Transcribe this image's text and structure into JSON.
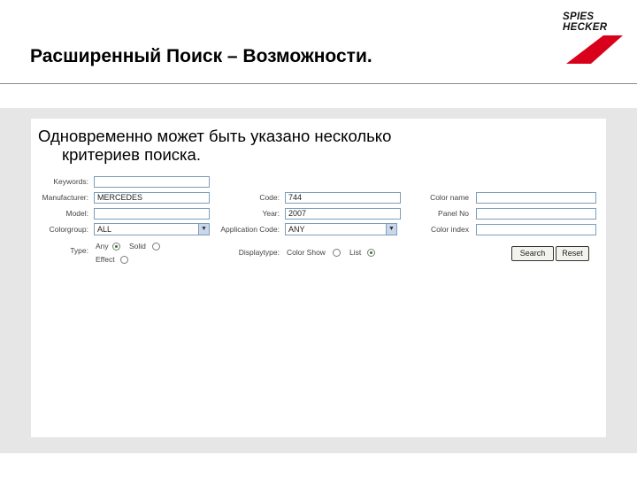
{
  "slide": {
    "title": "Расширенный Поиск – Возможности.",
    "logo_line1": "SPIES",
    "logo_line2": "HECKER",
    "brand_color": "#d9001b",
    "intro_line1": "Одновременно может быть указано несколько",
    "intro_line2": "критериев поиска."
  },
  "form": {
    "keywords_label": "Keywords:",
    "keywords_value": "",
    "manufacturer_label": "Manufacturer:",
    "manufacturer_value": "MERCEDES",
    "model_label": "Model:",
    "model_value": "",
    "colorgroup_label": "Colorgroup:",
    "colorgroup_value": "ALL",
    "type_label": "Type:",
    "type_options": [
      "Any",
      "Solid",
      "Effect"
    ],
    "type_selected": "Any",
    "code_label": "Code:",
    "code_value": "744",
    "year_label": "Year:",
    "year_value": "2007",
    "application_code_label": "Application Code:",
    "application_code_value": "ANY",
    "displaytype_label": "Displaytype:",
    "displaytype_options": [
      "Color Show",
      "List"
    ],
    "displaytype_selected": "List",
    "color_name_label": "Color name",
    "color_name_value": "",
    "panel_no_label": "Panel No",
    "panel_no_value": "",
    "color_index_label": "Color index",
    "color_index_value": "",
    "search_button": "Search",
    "reset_button": "Reset"
  }
}
